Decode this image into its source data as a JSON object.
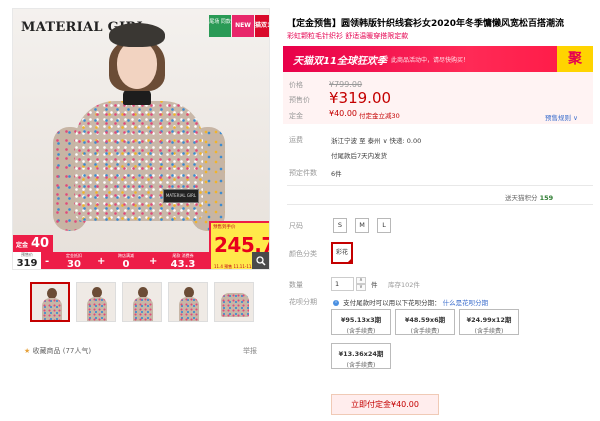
{
  "gallery": {
    "brand_logo": "MATERIAL GIRL",
    "tag_new_arrival": "尾场 同款",
    "tag_new": "NEW",
    "tag_festival": "猫双11",
    "model_patch": "MATERIAL GIRL",
    "deposit_label": "定金",
    "deposit_value": "40",
    "presale_caption": "预售到手价",
    "presale_price": "245.7",
    "presale_date": "11.4 预售 11.11-11.13",
    "calc": {
      "total_caption": "预售价",
      "total": "319",
      "items": [
        {
          "caption": "定金抵扣",
          "value": "30",
          "op": "-"
        },
        {
          "caption": "跨店满减",
          "value": "0",
          "op": "+"
        },
        {
          "caption": "尾款 消费券",
          "value": "43.3",
          "op": "+"
        }
      ]
    },
    "thumbnails_count": 5
  },
  "favorite": {
    "label": "收藏商品",
    "count": "(77人气)"
  },
  "report_label": "举报",
  "product": {
    "title": "【定金预售】圆领韩版针织线套衫女2020年冬季慵懒风宽松百搭潮流",
    "subtitle": "彩虹颗粒毛针织衫 舒适温暖穿搭限定款"
  },
  "event_banner": {
    "title": "天猫双11全球狂欢季",
    "note": "此商品活动中，请尽快购买！",
    "badge": "聚"
  },
  "price": {
    "orig_label": "价格",
    "orig_value": "¥799.00",
    "presale_label": "预售价",
    "presale_value": "¥319.00",
    "deposit_label": "定金",
    "deposit_value": "¥40.00",
    "deposit_offset": "付定金立减30",
    "rules_link": "预售规则 ∨"
  },
  "shipping": {
    "label": "运费",
    "line": "浙江宁波 至 泰州 ∨ 快递: 0.00",
    "time": "付尾款后7天内发货"
  },
  "presale_count": {
    "label": "预定件数",
    "value": "6件"
  },
  "stats": {
    "label": "送天猫积分",
    "value": "159"
  },
  "size": {
    "label": "尺码",
    "options": [
      "S",
      "M",
      "L"
    ]
  },
  "color": {
    "label": "颜色分类",
    "selected": "彩花"
  },
  "quantity": {
    "label": "数量",
    "value": "1",
    "increment": "∧",
    "decrement": "∨",
    "unit": "件",
    "stock": "库存102件"
  },
  "installment": {
    "label": "花呗分期",
    "note": "支付尾款时可以用以下花呗分期：",
    "link": "什么是花呗分期",
    "options": [
      {
        "amount": "¥95.13x3期",
        "fee": "(含手续费)"
      },
      {
        "amount": "¥48.59x6期",
        "fee": "(含手续费)"
      },
      {
        "amount": "¥24.99x12期",
        "fee": "(含手续费)"
      },
      {
        "amount": "¥13.36x24期",
        "fee": "(含手续费)"
      }
    ]
  },
  "buy_button": "立即付定金¥40.00",
  "colors": {
    "accent_red": "#c40000",
    "promo_pink": "#ed1d47",
    "link_blue": "#3c6ecd"
  }
}
